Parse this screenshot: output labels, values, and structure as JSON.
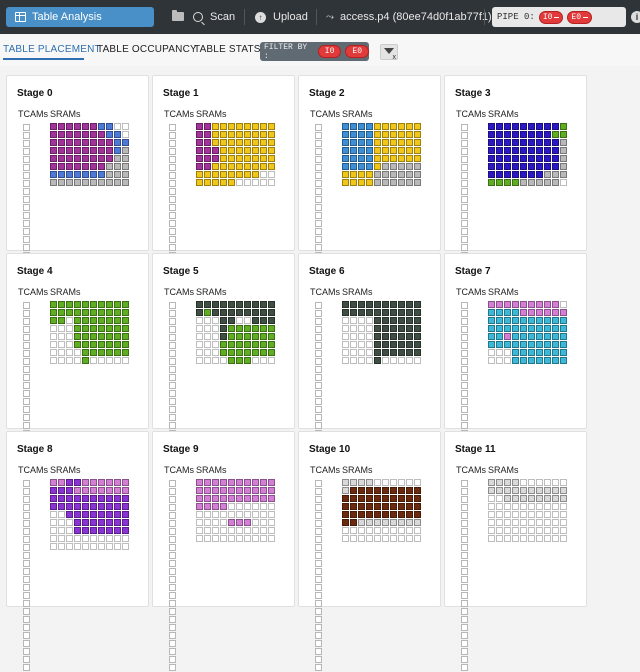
{
  "toolbar": {
    "tab_label": "Table Analysis",
    "scan_label": "Scan",
    "upload_label": "Upload",
    "file_label": "access.p4 (80ee74d0f1ab77f1)",
    "pipe_label": "PIPE 0:",
    "pipe_i0": "I0",
    "pipe_e0": "E0"
  },
  "tabs": [
    "TABLE PLACEMENT",
    "TABLE OCCUPANCY",
    "TABLE STATS"
  ],
  "active_tab": "TABLE PLACEMENT",
  "filter": {
    "label": "FILTER BY :",
    "chips": [
      "I0",
      "E0"
    ]
  },
  "labels": {
    "tcams": "TCAMs",
    "srams": "SRAMs"
  },
  "colors": {
    "accent": "#4a90c8",
    "pill": "#e03a3a",
    "M": "#a2339a",
    "B": "#4f79d9",
    "G": "#b9b9b9",
    "Y": "#f2c618",
    "L": "#3d8fd6",
    "P": "#2b17c4",
    "g": "#5fad20",
    "D": "#3e4e42",
    "K": "#2a302c",
    "T": "#3ab9d8",
    "p": "#d57ed6",
    "V": "#8a32d4",
    "R": "#6b2a10",
    "W": "#d9d9d9",
    ".": "#ffffff"
  },
  "stages": [
    {
      "name": "Stage 0",
      "grid": [
        "MMMMMMBB..",
        "MMMMMMMBB.",
        "MMMMMMMMBB",
        "MMMMMMMMBG",
        "MMMMMMMMGG",
        "MMMMMMMGGG",
        "BBBBBBBGGG",
        "GGGGGGGGGG"
      ]
    },
    {
      "name": "Stage 1",
      "grid": [
        "MMYYYYYYYY",
        "MMYYYYYYYY",
        "MMYYYYYYYY",
        "MMMYYYYYYY",
        "MMMYYYYYYY",
        "MMYYYYYYYY",
        "YYYYYYYY..",
        "YYYYY....."
      ]
    },
    {
      "name": "Stage 2",
      "grid": [
        "LLLLYYYYYY",
        "LLLLYYYYYY",
        "LLLLYYYYYY",
        "LLLLYYYYYY",
        "LLLLYYYYYY",
        "LLLLYGGGGG",
        "YYYYGGGGGG",
        "YYYYGGGGGG"
      ]
    },
    {
      "name": "Stage 3",
      "grid": [
        "PPPPPPPPPg",
        "PPPPPPPPgg",
        "PPPPPPPPPG",
        "PPPPPPPPPG",
        "PPPPPPPPPG",
        "PPPPPPPPPG",
        "PPPPPPPGGG",
        "ggggGGGGG."
      ]
    },
    {
      "name": "Stage 4",
      "grid": [
        "gggggggggg",
        "gggggggggg",
        "gg.ggggggg",
        "...ggggggg",
        "...ggggggg",
        "...ggggggg",
        "....gggggg",
        "....g....."
      ]
    },
    {
      "name": "Stage 5",
      "grid": [
        "DDDDDDDDDD",
        "DgDDDDDDDD",
        "...DD..DDD",
        "...Dgggggg",
        "...Dgggggg",
        "...ggggggg",
        "...ggggggg",
        "....ggg..."
      ]
    },
    {
      "name": "Stage 6",
      "grid": [
        "DDDDDDDDDD",
        "DDDDDDDDDD",
        "....DDDDDD",
        "....DDDDDD",
        "....DDDDDD",
        "....DDDDDD",
        "....DDDDDD",
        "....D....."
      ]
    },
    {
      "name": "Stage 7",
      "grid": [
        "ppppppppp.",
        "TTTTpppppp",
        "TTTTTTTTTT",
        "TTTTTTTTTT",
        "TTpTTTTTTT",
        "TTTTTTTTTT",
        "...TTTTTTT",
        "...TTTTTTT"
      ]
    },
    {
      "name": "Stage 8",
      "grid": [
        "ppVVpppppp",
        "VVVppppppp",
        "VVVVVVVVVV",
        "VVVVVVVVVV",
        "..VVVVVVVV",
        "...VVVVVVV",
        "...VVVVVVV",
        "..........",
        ".........."
      ]
    },
    {
      "name": "Stage 9",
      "grid": [
        "pppppppppp",
        "pppppppppp",
        "pppppppppp",
        "pppp......",
        "..........",
        "....ppp...",
        "..........",
        ".........."
      ]
    },
    {
      "name": "Stage 10",
      "grid": [
        "WWWW......",
        "WRRRRRRRRR",
        "RRRRRRRRRR",
        "RRRRRRRRRR",
        "RRRRRRRRRR",
        "RRWWWWWWWW",
        "..........",
        ".........."
      ]
    },
    {
      "name": "Stage 11",
      "grid": [
        "WWWW......",
        "WWWWWWWWWW",
        "..WWWWWWWW",
        "..........",
        "..........",
        "..........",
        "..........",
        ".........."
      ]
    }
  ]
}
